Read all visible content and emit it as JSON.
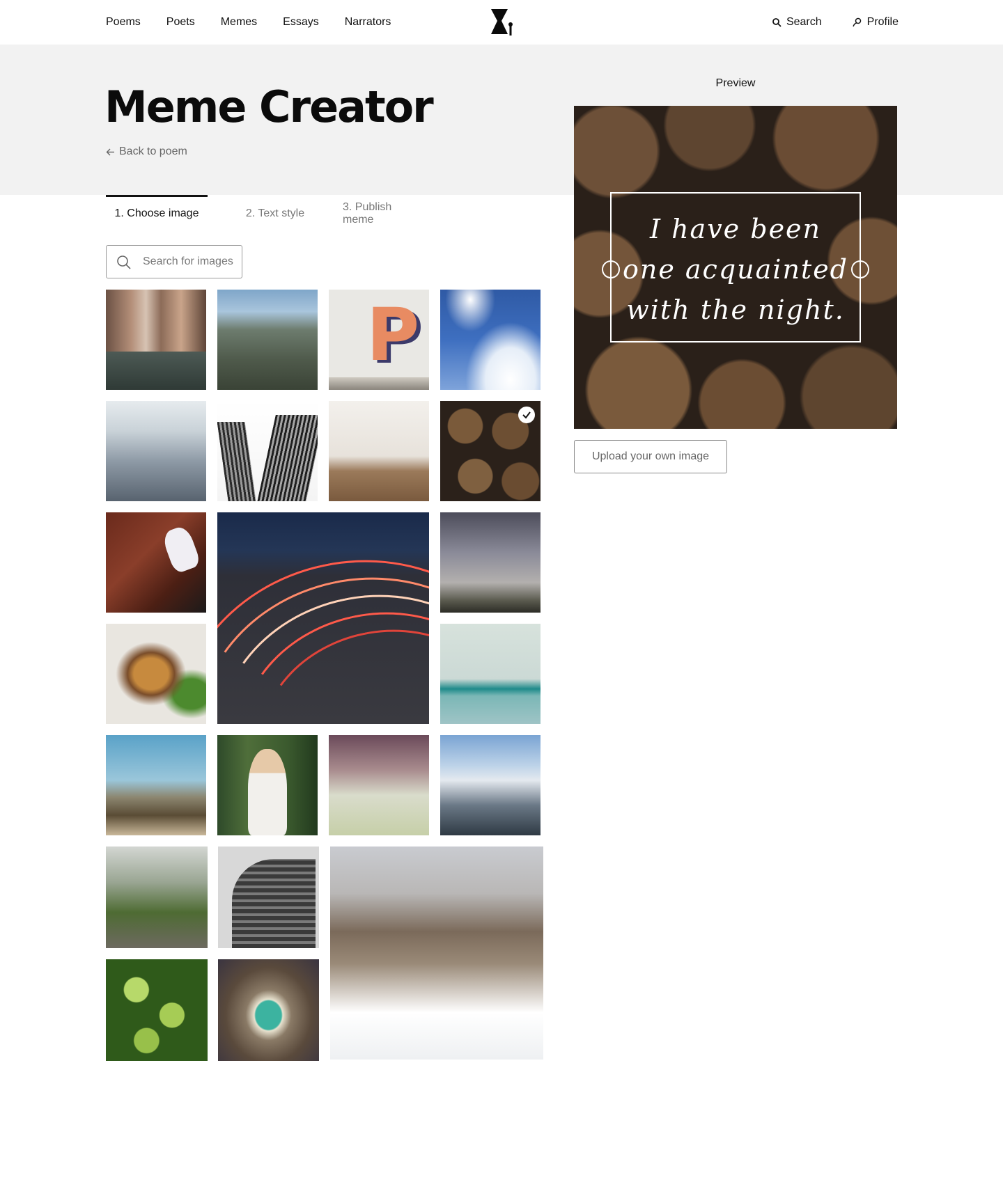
{
  "nav": {
    "links": [
      "Poems",
      "Poets",
      "Memes",
      "Essays",
      "Narrators"
    ],
    "search_label": "Search",
    "profile_label": "Profile"
  },
  "page": {
    "title": "Meme Creator",
    "back_label": "Back to poem"
  },
  "tabs": [
    {
      "label": "1. Choose image",
      "active": true
    },
    {
      "label": "2. Text style",
      "active": false
    },
    {
      "label": "3. Publish meme",
      "active": false
    }
  ],
  "image_search": {
    "placeholder": "Search for images"
  },
  "thumbnails": {
    "letter_p": "P",
    "selected": "logs"
  },
  "preview": {
    "label": "Preview",
    "meme_text": "I have been one acquainted with the night."
  },
  "upload_label": "Upload your own image",
  "colors": {
    "accent": "#111111",
    "hero_background": "#f2f2f2",
    "muted_text": "#777777"
  },
  "icons": [
    "logo-icon",
    "search-icon",
    "profile-icon",
    "arrow-left-icon",
    "magnifier-icon",
    "check-icon",
    "resize-handle-icon"
  ]
}
